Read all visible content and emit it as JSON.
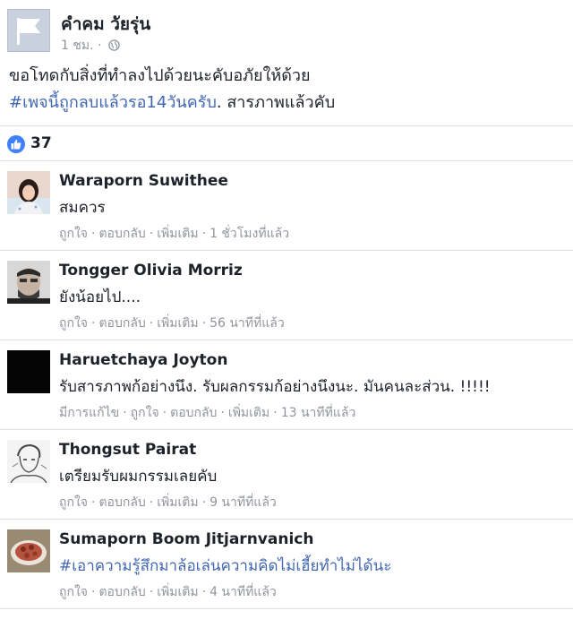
{
  "post": {
    "page_name": "คำคม วัยรุ่น",
    "time": "1 ชม.",
    "separator": "·",
    "line1": "ขอโทดกับสิ่งที่ทำลงไปด้วยนะคับอภัยให้ด้วย",
    "hashtag": "#เพจนี้ถูกลบแล้วรอ14วันครับ",
    "line2_rest": ". สารภาพแล้วคับ"
  },
  "likes": {
    "count": "37",
    "icon": "thumbs-up-icon",
    "icon_color": "#4080ff"
  },
  "colors": {
    "link": "#4267b2",
    "meta": "#90949c",
    "text": "#1d2129",
    "divider": "#dddfe2"
  },
  "comments": [
    {
      "name": "Waraporn Suwithee",
      "text": "สมควร",
      "is_hashtag": false,
      "edited": "",
      "like": "ถูกใจ",
      "reply": "ตอบกลับ",
      "more": "เพิ่มเติม",
      "time": "1 ชั่วโมงที่แล้ว"
    },
    {
      "name": "Tongger Olivia Morriz",
      "text": "ยังน้อยไป....",
      "is_hashtag": false,
      "edited": "",
      "like": "ถูกใจ",
      "reply": "ตอบกลับ",
      "more": "เพิ่มเติม",
      "time": "56 นาทีที่แล้ว"
    },
    {
      "name": "Haruetchaya Joyton",
      "text": "รับสารภาพก้อย่างนึง. รับผลกรรมก้อย่างนึงนะ. มันคนละส่วน. !!!!!",
      "is_hashtag": false,
      "edited": "มีการแก้ไข",
      "like": "ถูกใจ",
      "reply": "ตอบกลับ",
      "more": "เพิ่มเติม",
      "time": "13 นาทีที่แล้ว"
    },
    {
      "name": "Thongsut Pairat",
      "text": "เตรียมรับผมกรรมเลยคับ",
      "is_hashtag": false,
      "edited": "",
      "like": "ถูกใจ",
      "reply": "ตอบกลับ",
      "more": "เพิ่มเติม",
      "time": "9 นาทีที่แล้ว"
    },
    {
      "name": "Sumaporn Boom Jitjarnvanich",
      "text": "#เอาความรู้สึกมาล้อเล่นความคิดไม่เฮี้ยทำไม่ได้นะ",
      "is_hashtag": true,
      "edited": "",
      "like": "ถูกใจ",
      "reply": "ตอบกลับ",
      "more": "เพิ่มเติม",
      "time": "4 นาทีที่แล้ว"
    }
  ]
}
